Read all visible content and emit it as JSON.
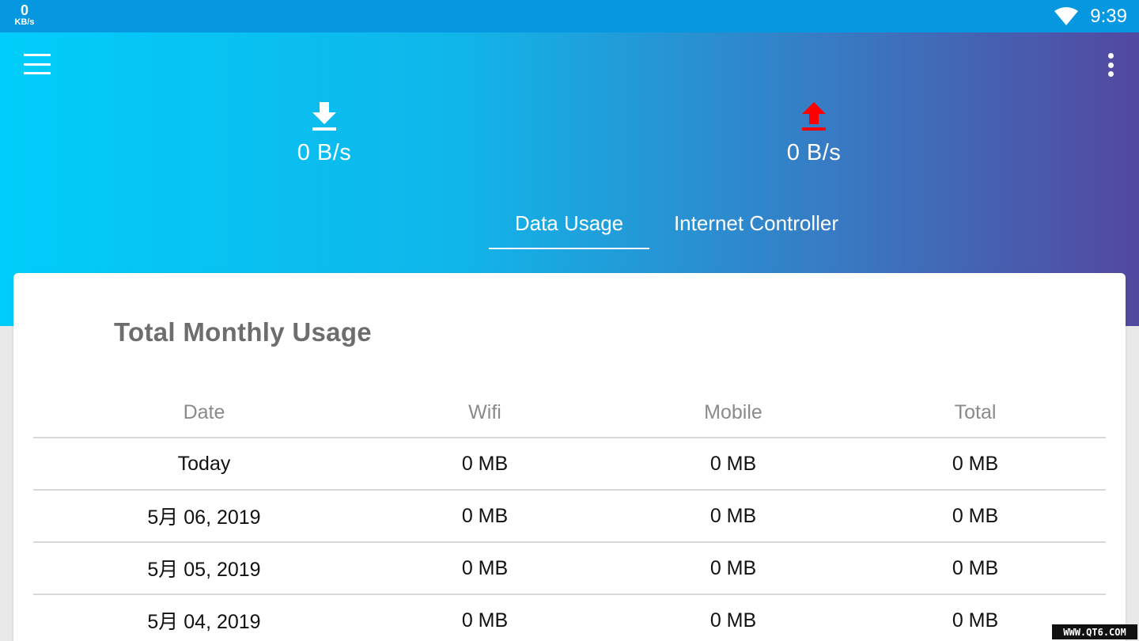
{
  "status_bar": {
    "net_speed_value": "0",
    "net_speed_unit": "KB/s",
    "time": "9:39",
    "wifi_icon": "wifi-icon"
  },
  "header": {
    "menu_icon": "hamburger-menu-icon",
    "overflow_icon": "more-vert-icon",
    "download": {
      "icon": "download-arrow-icon",
      "value": "0 B/s",
      "color": "#ffffff"
    },
    "upload": {
      "icon": "upload-arrow-icon",
      "value": "0 B/s",
      "color": "#ff0000"
    },
    "tabs": [
      {
        "label": "Data Usage",
        "active": true
      },
      {
        "label": "Internet Controller",
        "active": false
      }
    ]
  },
  "card": {
    "title": "Total Monthly Usage",
    "columns": [
      "Date",
      "Wifi",
      "Mobile",
      "Total"
    ],
    "rows": [
      {
        "date": "Today",
        "wifi": "0 MB",
        "mobile": "0 MB",
        "total": "0 MB"
      },
      {
        "date": "5月 06, 2019",
        "wifi": "0 MB",
        "mobile": "0 MB",
        "total": "0 MB"
      },
      {
        "date": "5月 05, 2019",
        "wifi": "0 MB",
        "mobile": "0 MB",
        "total": "0 MB"
      },
      {
        "date": "5月 04, 2019",
        "wifi": "0 MB",
        "mobile": "0 MB",
        "total": "0 MB"
      }
    ]
  },
  "watermark": "WWW.QT6.COM",
  "colors": {
    "status_bar": "#0598e0",
    "gradient_start": "#00cdfb",
    "gradient_end": "#5348a0",
    "upload_arrow": "#ff0000"
  }
}
